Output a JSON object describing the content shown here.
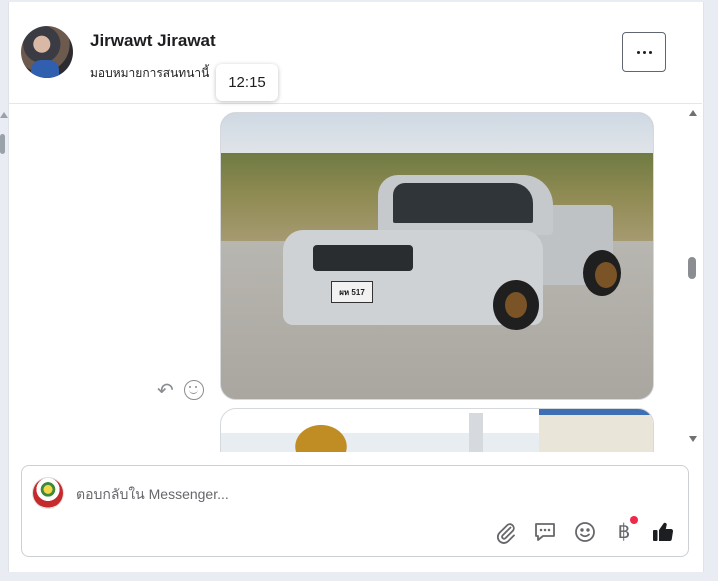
{
  "conversation": {
    "contact_name": "Jirwawt Jirawat",
    "subtitle": "มอบหมายการสนทนานี้",
    "more_label": "More options",
    "tooltip_time": "12:15"
  },
  "messages": [
    {
      "type": "image",
      "description_icon": "pickup-truck-photo",
      "plate_text": "ผห 517"
    },
    {
      "type": "image",
      "description_icon": "temple-photo"
    }
  ],
  "composer": {
    "placeholder": "ตอบกลับใน Messenger...",
    "tools": [
      "attachment-icon",
      "saved-reply-icon",
      "emoji-icon",
      "baht-payment-icon",
      "thumbs-up-icon"
    ],
    "baht_symbol": "฿"
  },
  "colors": {
    "accent": "#1c1e21",
    "notification": "#f0284a",
    "icon_gray": "#65676b"
  }
}
